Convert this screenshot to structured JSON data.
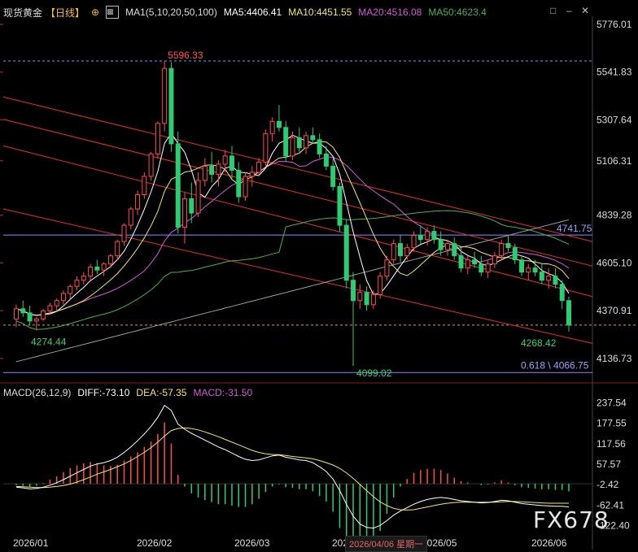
{
  "header": {
    "symbol": "现货黄金",
    "period": "【日线】",
    "ma_label": "MA1(5,10,20,50,100)",
    "ma5": "MA5:4406.41",
    "ma10": "MA10:4451.55",
    "ma20": "MA20:4516.08",
    "ma50": "MA50:4623.4"
  },
  "macd_header": {
    "label": "MACD(26,12,9)",
    "diff": "DIFF:-73.10",
    "dea": "DEA:-57.35",
    "macd": "MACD:-31.50"
  },
  "colors": {
    "up": "#ff4d4d",
    "down": "#2ecc71",
    "ma5": "#ffffff",
    "ma10": "#f5e663",
    "ma20": "#d05bd8",
    "ma50": "#4caf50",
    "ma100": "#9e9e9e",
    "channel": "#e03030",
    "hline_blue": "#8a8aff"
  },
  "watermark": "FX678",
  "hover_date": "2026/04/06 星期一",
  "chart_data": {
    "type": "candlestick",
    "price_axis": {
      "ticks": [
        "5776.01",
        "5541.83",
        "5307.64",
        "5106.31",
        "4839.28",
        "4605.10",
        "4370.91",
        "4136.73"
      ],
      "ylim": [
        4020,
        5800
      ]
    },
    "macd_axis": {
      "ticks": [
        "237.54",
        "177.55",
        "117.56",
        "57.57",
        "-2.42",
        "-62.41",
        "-122.40"
      ],
      "ylim": [
        -150,
        260
      ]
    },
    "x_labels": [
      "2026/01",
      "2026/02",
      "2026/03",
      "2026/04",
      "2026/05",
      "2026/06"
    ],
    "annotations": {
      "high": "5596.33",
      "low": "4099.02",
      "start_low": "4274.44",
      "recent_low": "4268.42",
      "level_blue": "4741.75",
      "fib": "0.618 \\ 4066.75",
      "dashed_right": "4370.91"
    },
    "candles": [
      [
        4330,
        4400,
        4290,
        4380
      ],
      [
        4380,
        4420,
        4340,
        4360
      ],
      [
        4360,
        4395,
        4300,
        4320
      ],
      [
        4320,
        4340,
        4274,
        4330
      ],
      [
        4330,
        4380,
        4320,
        4370
      ],
      [
        4370,
        4410,
        4350,
        4395
      ],
      [
        4395,
        4430,
        4370,
        4420
      ],
      [
        4420,
        4470,
        4400,
        4455
      ],
      [
        4455,
        4500,
        4430,
        4490
      ],
      [
        4490,
        4540,
        4470,
        4520
      ],
      [
        4520,
        4560,
        4500,
        4540
      ],
      [
        4540,
        4600,
        4520,
        4585
      ],
      [
        4585,
        4620,
        4550,
        4570
      ],
      [
        4570,
        4610,
        4540,
        4600
      ],
      [
        4600,
        4650,
        4580,
        4640
      ],
      [
        4640,
        4720,
        4620,
        4710
      ],
      [
        4710,
        4800,
        4690,
        4790
      ],
      [
        4790,
        4880,
        4770,
        4870
      ],
      [
        4870,
        4960,
        4840,
        4940
      ],
      [
        4940,
        5050,
        4920,
        5030
      ],
      [
        5030,
        5150,
        5010,
        5140
      ],
      [
        5140,
        5300,
        5120,
        5290
      ],
      [
        5290,
        5596,
        5250,
        5560
      ],
      [
        5560,
        5590,
        5150,
        5190
      ],
      [
        5190,
        5250,
        4750,
        4780
      ],
      [
        4780,
        4950,
        4700,
        4920
      ],
      [
        4920,
        5000,
        4800,
        4850
      ],
      [
        4850,
        5050,
        4830,
        5010
      ],
      [
        5010,
        5120,
        4980,
        5080
      ],
      [
        5080,
        5150,
        5000,
        5040
      ],
      [
        5040,
        5110,
        4980,
        5090
      ],
      [
        5090,
        5160,
        5050,
        5130
      ],
      [
        5130,
        5180,
        5020,
        5060
      ],
      [
        5060,
        5100,
        4900,
        4930
      ],
      [
        4930,
        5050,
        4910,
        5030
      ],
      [
        5030,
        5080,
        4980,
        5050
      ],
      [
        5050,
        5120,
        5030,
        5100
      ],
      [
        5100,
        5260,
        5080,
        5240
      ],
      [
        5240,
        5320,
        5200,
        5300
      ],
      [
        5300,
        5380,
        5250,
        5270
      ],
      [
        5270,
        5300,
        5100,
        5130
      ],
      [
        5130,
        5250,
        5110,
        5220
      ],
      [
        5220,
        5270,
        5150,
        5170
      ],
      [
        5170,
        5250,
        5140,
        5230
      ],
      [
        5230,
        5270,
        5190,
        5210
      ],
      [
        5210,
        5240,
        5120,
        5140
      ],
      [
        5140,
        5180,
        5060,
        5080
      ],
      [
        5080,
        5120,
        4960,
        4980
      ],
      [
        4980,
        5000,
        4760,
        4790
      ],
      [
        4790,
        4820,
        4480,
        4520
      ],
      [
        4520,
        4560,
        4099,
        4420
      ],
      [
        4420,
        4500,
        4380,
        4460
      ],
      [
        4460,
        4490,
        4370,
        4400
      ],
      [
        4400,
        4470,
        4380,
        4450
      ],
      [
        4450,
        4560,
        4430,
        4540
      ],
      [
        4540,
        4640,
        4520,
        4620
      ],
      [
        4620,
        4720,
        4600,
        4700
      ],
      [
        4700,
        4740,
        4610,
        4640
      ],
      [
        4640,
        4700,
        4620,
        4680
      ],
      [
        4680,
        4760,
        4660,
        4740
      ],
      [
        4740,
        4790,
        4690,
        4720
      ],
      [
        4720,
        4780,
        4690,
        4760
      ],
      [
        4760,
        4790,
        4700,
        4720
      ],
      [
        4720,
        4760,
        4640,
        4670
      ],
      [
        4670,
        4720,
        4640,
        4700
      ],
      [
        4700,
        4730,
        4620,
        4640
      ],
      [
        4640,
        4680,
        4560,
        4580
      ],
      [
        4580,
        4640,
        4550,
        4620
      ],
      [
        4620,
        4660,
        4580,
        4600
      ],
      [
        4600,
        4640,
        4540,
        4560
      ],
      [
        4560,
        4620,
        4530,
        4600
      ],
      [
        4600,
        4660,
        4580,
        4640
      ],
      [
        4640,
        4720,
        4620,
        4700
      ],
      [
        4700,
        4740,
        4660,
        4680
      ],
      [
        4680,
        4700,
        4600,
        4620
      ],
      [
        4620,
        4640,
        4540,
        4560
      ],
      [
        4560,
        4600,
        4520,
        4580
      ],
      [
        4580,
        4620,
        4540,
        4560
      ],
      [
        4560,
        4600,
        4500,
        4520
      ],
      [
        4520,
        4580,
        4480,
        4540
      ],
      [
        4540,
        4580,
        4480,
        4500
      ],
      [
        4500,
        4520,
        4380,
        4420
      ],
      [
        4420,
        4440,
        4268,
        4300
      ]
    ],
    "macd": {
      "diff": [
        -10,
        -12,
        -15,
        -14,
        -10,
        -4,
        3,
        12,
        22,
        32,
        42,
        52,
        58,
        62,
        68,
        78,
        92,
        108,
        126,
        146,
        168,
        195,
        230,
        215,
        175,
        160,
        148,
        138,
        128,
        118,
        108,
        100,
        90,
        80,
        72,
        68,
        70,
        76,
        82,
        84,
        78,
        74,
        70,
        68,
        62,
        50,
        36,
        14,
        -20,
        -60,
        -95,
        -118,
        -128,
        -130,
        -122,
        -108,
        -92,
        -80,
        -70,
        -60,
        -52,
        -46,
        -42,
        -40,
        -42,
        -46,
        -50,
        -52,
        -54,
        -56,
        -55,
        -52,
        -48,
        -50,
        -54,
        -58,
        -60,
        -62,
        -64,
        -65,
        -66,
        -66,
        -68,
        -73
      ],
      "dea": [
        -8,
        -9,
        -10,
        -11,
        -11,
        -10,
        -8,
        -5,
        -1,
        5,
        12,
        20,
        28,
        35,
        42,
        50,
        58,
        68,
        80,
        92,
        106,
        122,
        140,
        156,
        162,
        164,
        162,
        158,
        152,
        145,
        138,
        130,
        122,
        114,
        106,
        98,
        92,
        88,
        86,
        85,
        83,
        80,
        78,
        76,
        73,
        68,
        62,
        55,
        45,
        32,
        16,
        -2,
        -20,
        -38,
        -53,
        -64,
        -72,
        -76,
        -77,
        -76,
        -72,
        -68,
        -64,
        -60,
        -57,
        -55,
        -54,
        -54,
        -54,
        -54,
        -54,
        -54,
        -53,
        -52,
        -52,
        -53,
        -54,
        -55,
        -56,
        -57,
        -57,
        -57,
        -57,
        -57
      ]
    }
  }
}
